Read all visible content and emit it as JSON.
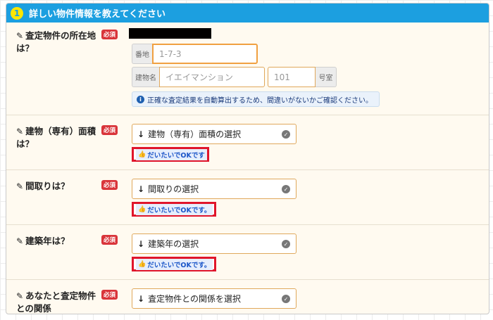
{
  "header": {
    "step": "1",
    "title": "詳しい物件情報を教えてください"
  },
  "required_badge": "必須",
  "q1": {
    "label": "査定物件の所在地は？",
    "banchi_addon": "番地",
    "banchi_placeholder": "1-7-3",
    "building_addon": "建物名",
    "building_placeholder": "イエイマンション",
    "room_placeholder": "101",
    "room_addon": "号室",
    "notice": "正確な査定結果を自動算出するため、間違いがないかご確認ください。"
  },
  "q2": {
    "label": "建物（専有）面積は？",
    "select": "建物（専有）面積の選択",
    "ok": "だいたいでOKです"
  },
  "q3": {
    "label": "間取りは？",
    "select": "間取りの選択",
    "ok": "だいたいでOKです。"
  },
  "q4": {
    "label": "建築年は？",
    "select": "建築年の選択",
    "ok": "だいたいでOKです。"
  },
  "q5": {
    "label": "あなたと査定物件との関係",
    "select": "査定物件との関係を選択"
  }
}
